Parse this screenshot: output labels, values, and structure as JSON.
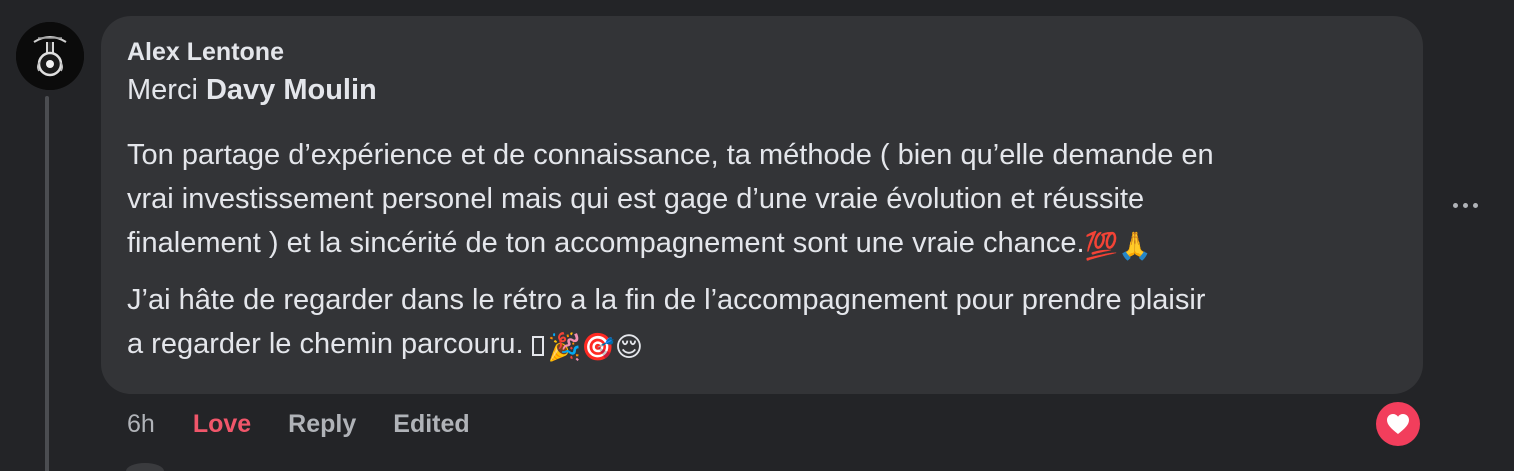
{
  "comment": {
    "author": "Alex Lentone",
    "greeting": "Merci",
    "mention": "Davy Moulin",
    "paragraph1": {
      "line1": "Ton partage d’expérience et de connaissance, ta méthode ( bien qu’elle demande en",
      "line2": "vrai investissement personel mais qui est gage d’une vraie évolution et réussite",
      "line3": "finalement ) et la sincérité de ton accompagnement sont une vraie chance.",
      "emojis": [
        "💯",
        "🙏"
      ]
    },
    "paragraph2": {
      "line1": "J’ai hâte de regarder dans le rétro a la fin de l’accompagnement pour prendre plaisir",
      "line2": "a regarder le chemin parcouru. ",
      "emojis": [
        "🎉",
        "🎯",
        "😌"
      ]
    }
  },
  "actions": {
    "time": "6h",
    "love": "Love",
    "reply": "Reply",
    "edited": "Edited"
  },
  "reaction": {
    "type": "love",
    "icon": "heart-icon",
    "color": "#f23e5c"
  },
  "more_menu": {
    "icon": "more-horizontal-icon"
  },
  "colors": {
    "background": "#232427",
    "bubble": "#333437",
    "text": "#e4e6eb",
    "secondary_text": "#b0b3b8",
    "love_accent": "#f0566a"
  }
}
